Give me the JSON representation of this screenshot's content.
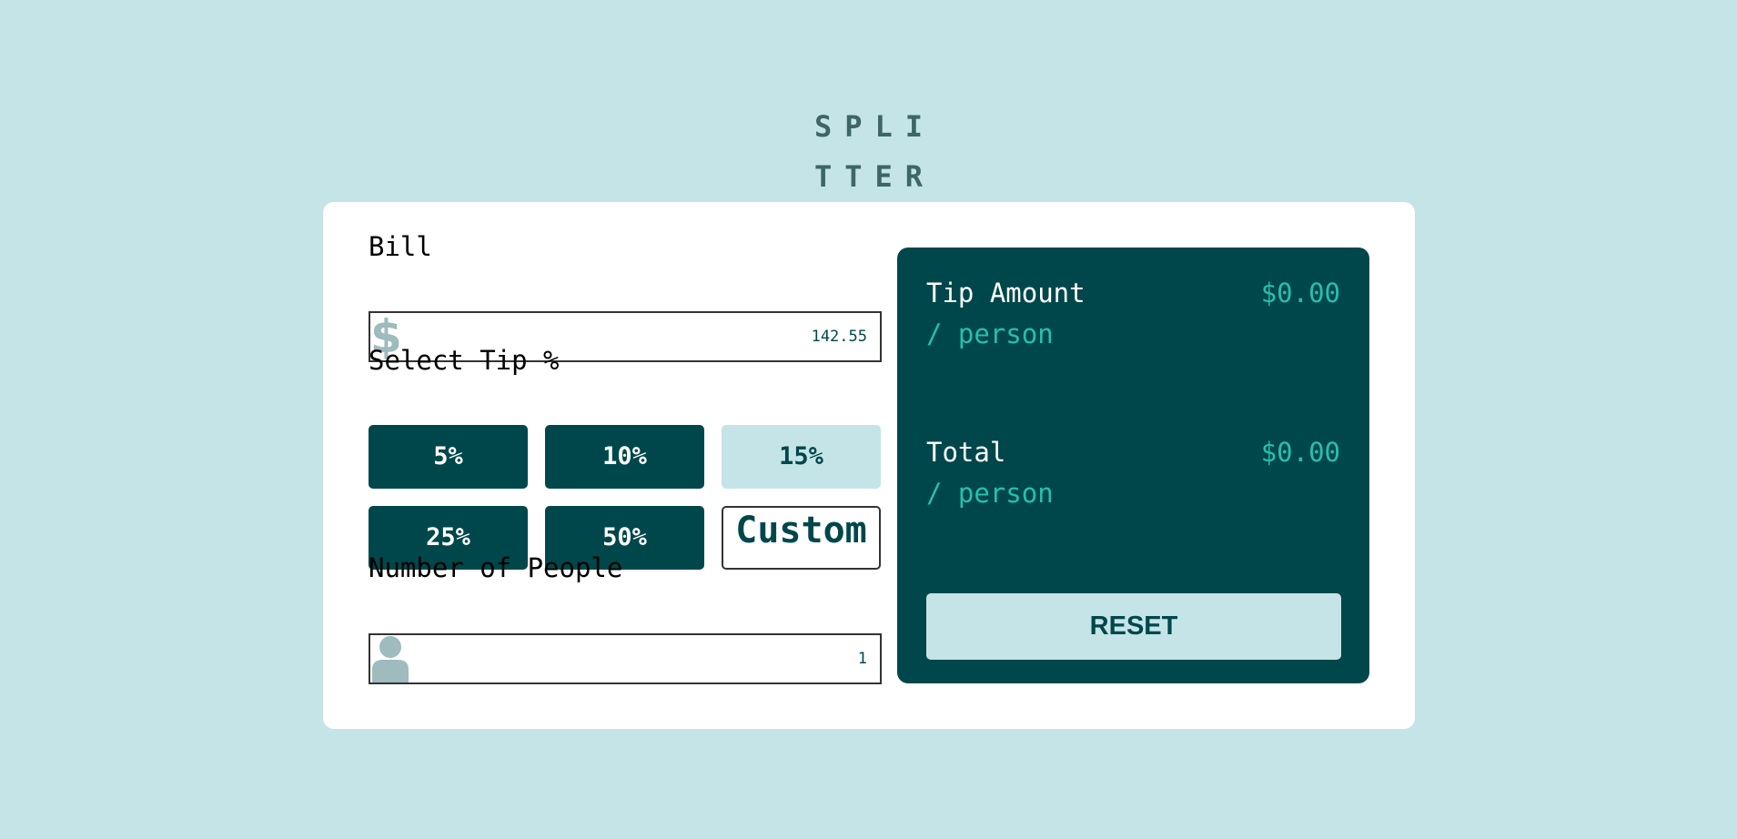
{
  "app": {
    "logo_line1": "SPLI",
    "logo_line2": "TTER"
  },
  "bill": {
    "label": "Bill",
    "value": "142.55",
    "icon": "dollar-icon",
    "icon_glyph": "$"
  },
  "tip": {
    "label": "Select Tip %",
    "options": [
      {
        "label": "5%",
        "selected": false
      },
      {
        "label": "10%",
        "selected": false
      },
      {
        "label": "15%",
        "selected": true
      },
      {
        "label": "25%",
        "selected": false
      },
      {
        "label": "50%",
        "selected": false
      }
    ],
    "custom_label": "Custom"
  },
  "people": {
    "label": "Number of People",
    "value": "1",
    "icon": "person-icon"
  },
  "results": {
    "tip_amount_label": "Tip Amount",
    "tip_amount_sub": "/ person",
    "tip_amount_value": "$0.00",
    "total_label": "Total",
    "total_sub": "/ person",
    "total_value": "$0.00",
    "reset_label": "RESET"
  },
  "colors": {
    "background": "#c5e4e7",
    "card": "#ffffff",
    "dark_teal": "#00474b",
    "accent": "#26c0ab",
    "logo": "#3d6666",
    "icon_gray": "#9ebbbd"
  }
}
